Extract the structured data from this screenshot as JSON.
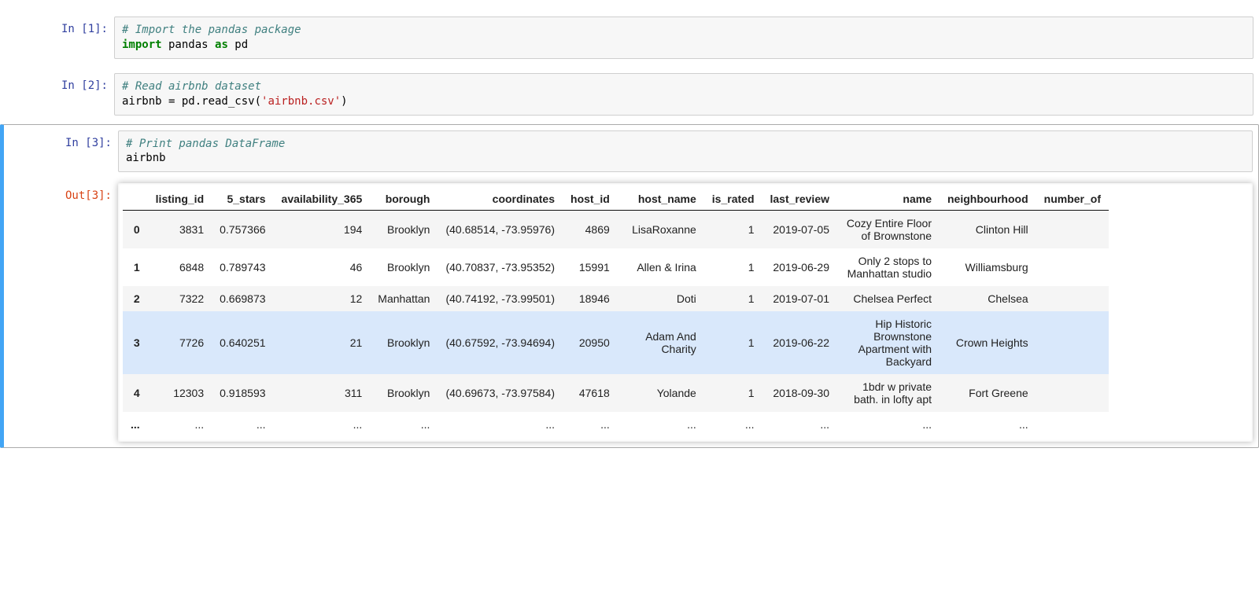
{
  "cells": [
    {
      "prompt": "In [1]:",
      "code_comment": "# Import the pandas package",
      "code_line2_kw1": "import",
      "code_line2_id1": " pandas ",
      "code_line2_kw2": "as",
      "code_line2_id2": " pd"
    },
    {
      "prompt": "In [2]:",
      "code_comment": "# Read airbnb dataset",
      "code_line2_id1": "airbnb = pd.read_csv(",
      "code_line2_str": "'airbnb.csv'",
      "code_line2_id2": ")"
    },
    {
      "prompt": "In [3]:",
      "code_comment": "# Print pandas DataFrame",
      "code_line2_id1": "airbnb",
      "out_prompt": "Out[3]:"
    }
  ],
  "table": {
    "columns": [
      "",
      "listing_id",
      "5_stars",
      "availability_365",
      "borough",
      "coordinates",
      "host_id",
      "host_name",
      "is_rated",
      "last_review",
      "name",
      "neighbourhood",
      "number_of"
    ],
    "rows": [
      {
        "idx": "0",
        "listing_id": "3831",
        "five_stars": "0.757366",
        "avail": "194",
        "borough": "Brooklyn",
        "coords": "(40.68514, -73.95976)",
        "host_id": "4869",
        "host_name": "LisaRoxanne",
        "is_rated": "1",
        "last_review": "2019-07-05",
        "name": "Cozy Entire Floor of Brownstone",
        "neigh": "Clinton Hill"
      },
      {
        "idx": "1",
        "listing_id": "6848",
        "five_stars": "0.789743",
        "avail": "46",
        "borough": "Brooklyn",
        "coords": "(40.70837, -73.95352)",
        "host_id": "15991",
        "host_name": "Allen & Irina",
        "is_rated": "1",
        "last_review": "2019-06-29",
        "name": "Only 2 stops to Manhattan studio",
        "neigh": "Williamsburg"
      },
      {
        "idx": "2",
        "listing_id": "7322",
        "five_stars": "0.669873",
        "avail": "12",
        "borough": "Manhattan",
        "coords": "(40.74192, -73.99501)",
        "host_id": "18946",
        "host_name": "Doti",
        "is_rated": "1",
        "last_review": "2019-07-01",
        "name": "Chelsea Perfect",
        "neigh": "Chelsea"
      },
      {
        "idx": "3",
        "listing_id": "7726",
        "five_stars": "0.640251",
        "avail": "21",
        "borough": "Brooklyn",
        "coords": "(40.67592, -73.94694)",
        "host_id": "20950",
        "host_name": "Adam And Charity",
        "is_rated": "1",
        "last_review": "2019-06-22",
        "name": "Hip Historic Brownstone Apartment with Backyard",
        "neigh": "Crown Heights",
        "hl": true
      },
      {
        "idx": "4",
        "listing_id": "12303",
        "five_stars": "0.918593",
        "avail": "311",
        "borough": "Brooklyn",
        "coords": "(40.69673, -73.97584)",
        "host_id": "47618",
        "host_name": "Yolande",
        "is_rated": "1",
        "last_review": "2018-09-30",
        "name": "1bdr w private bath. in lofty apt",
        "neigh": "Fort Greene"
      },
      {
        "idx": "...",
        "listing_id": "...",
        "five_stars": "...",
        "avail": "...",
        "borough": "...",
        "coords": "...",
        "host_id": "...",
        "host_name": "...",
        "is_rated": "...",
        "last_review": "...",
        "name": "...",
        "neigh": "..."
      }
    ]
  }
}
